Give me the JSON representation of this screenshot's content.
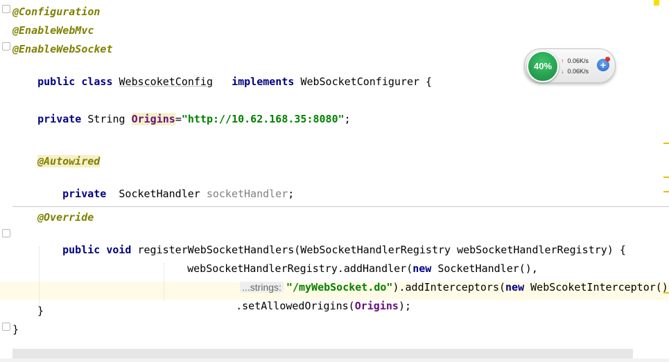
{
  "code": {
    "l1": "@Configuration",
    "l2": "@EnableWebMvc",
    "l3": "@EnableWebSocket",
    "l4": {
      "kw": "public class",
      "cls": "WebscoketConfig",
      "kw2": "implements",
      "iface": "WebSocketConfigurer {"
    },
    "l5": {
      "kw": "private",
      "type": "String",
      "field": "Origins",
      "eq": "=",
      "str": "\"http://10.62.168.35:8080\"",
      "end": ";"
    },
    "l6": "@Autowired",
    "l7": {
      "kw": "private",
      "type": "SocketHandler",
      "var": "socketHandler",
      "end": ";"
    },
    "l8": "@Override",
    "l9": {
      "kw": "public void",
      "rest": "registerWebSocketHandlers(WebSocketHandlerRegistry webSocketHandlerRegistry) {"
    },
    "l10": {
      "a": "webSocketHandlerRegistry.addHandler(",
      "kw": "new",
      "b": "SocketHandler(),"
    },
    "l11": {
      "hint": "...strings:",
      "str": "\"/myWebSocket.do\"",
      "a": ").addInterceptors(",
      "kw": "new",
      "b": "WebScoketInterceptor())"
    },
    "l12": {
      "a": ".setAllowedOrigins(",
      "field": "Origins",
      "b": ");"
    },
    "l13": "}",
    "l14": "}"
  },
  "widget": {
    "percent": "40%",
    "up": "0.06K/s",
    "down": "0.06K/s",
    "plus": "+",
    "colors": {
      "ring": "#1a8a3e",
      "up": "#d83a2a",
      "down": "#2a9a3a",
      "plus": "#2a66c4"
    }
  }
}
